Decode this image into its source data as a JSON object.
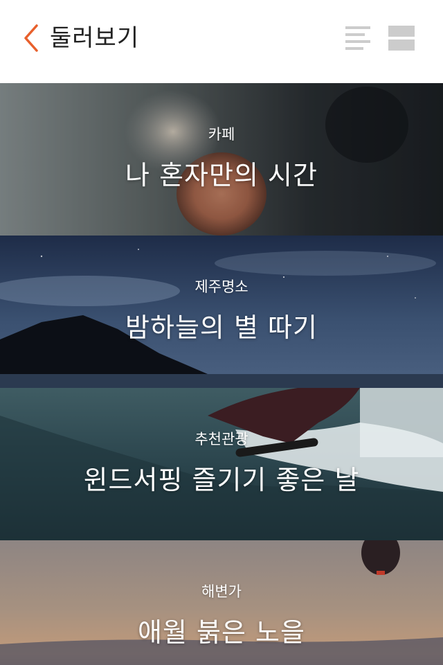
{
  "header": {
    "title": "둘러보기",
    "accent_color": "#e8602c",
    "icon_color": "#cccccc",
    "back_icon": "chevron-left-icon",
    "list_view_icon": "list-view-icon",
    "card_view_icon": "card-view-icon"
  },
  "cards": [
    {
      "category": "카페",
      "headline": "나 혼자만의 시간",
      "image": "vinyl-record-photo"
    },
    {
      "category": "제주명소",
      "headline": "밤하늘의 별 따기",
      "image": "night-sky-mountain-photo"
    },
    {
      "category": "추천관광",
      "headline": "윈드서핑 즐기기 좋은 날",
      "image": "surfer-wave-photo"
    },
    {
      "category": "해변가",
      "headline": "애월 붉은 노을",
      "image": "sunset-balloon-photo"
    }
  ]
}
